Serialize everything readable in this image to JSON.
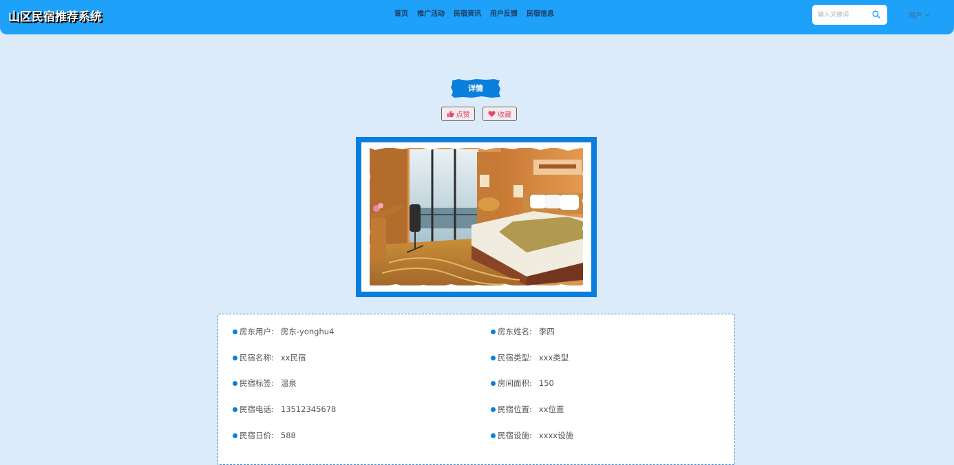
{
  "header": {
    "title": "山区民宿推荐系统",
    "nav": [
      "首页",
      "推广活动",
      "民宿资讯",
      "用户反馈",
      "民宿信息"
    ],
    "search_placeholder": "输入关键词",
    "user_label": "用户"
  },
  "detail": {
    "banner": "详情",
    "like_label": "点赞",
    "favorite_label": "收藏"
  },
  "info": {
    "left": [
      {
        "label": "房东用户:",
        "value": "房东-yonghu4"
      },
      {
        "label": "民宿名称:",
        "value": "xx民宿"
      },
      {
        "label": "民宿标签:",
        "value": "温泉"
      },
      {
        "label": "民宿电话:",
        "value": "13512345678"
      },
      {
        "label": "民宿日价:",
        "value": "588"
      }
    ],
    "right": [
      {
        "label": "房东姓名:",
        "value": "李四"
      },
      {
        "label": "民宿类型:",
        "value": "xxx类型"
      },
      {
        "label": "房间面积:",
        "value": "150"
      },
      {
        "label": "民宿位置:",
        "value": "xx位置"
      },
      {
        "label": "民宿设施:",
        "value": "xxxx设施"
      }
    ]
  },
  "colors": {
    "header": "#1ea1f9",
    "accent": "#0a7edd",
    "page_bg": "#dcebf9",
    "action_text": "#e5476b"
  },
  "icons": [
    "search-icon",
    "caret-down-icon",
    "thumbs-up-icon",
    "heart-icon"
  ]
}
